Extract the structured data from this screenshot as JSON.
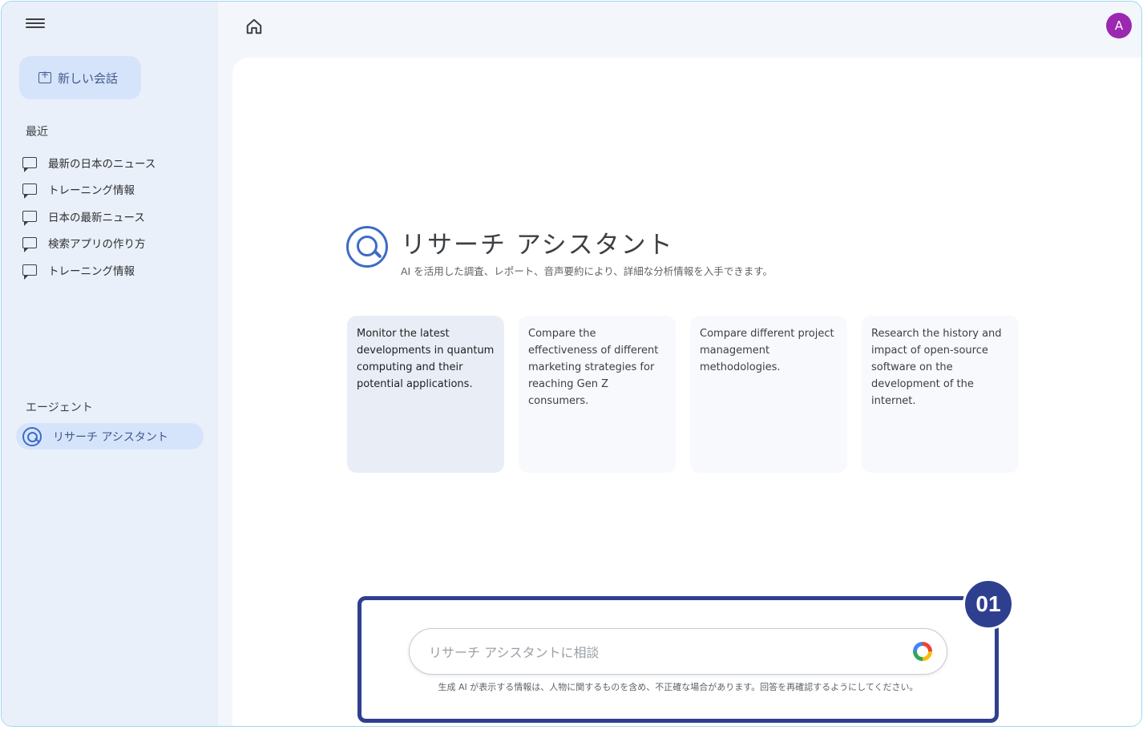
{
  "sidebar": {
    "new_chat_label": "新しい会話",
    "recent_label": "最近",
    "recent_items": [
      {
        "label": "最新の日本のニュース"
      },
      {
        "label": "トレーニング情報"
      },
      {
        "label": "日本の最新ニュース"
      },
      {
        "label": "検索アプリの作り方"
      },
      {
        "label": "トレーニング情報"
      }
    ],
    "agents_label": "エージェント",
    "agent_item_label": "リサーチ アシスタント"
  },
  "header": {
    "avatar_initial": "A"
  },
  "hero": {
    "title": "リサーチ アシスタント",
    "subtitle": "AI を活用した調査、レポート、音声要約により、詳細な分析情報を入手できます。"
  },
  "suggestions": [
    {
      "text": "Monitor the latest developments in quantum computing and their potential applications."
    },
    {
      "text": "Compare the effectiveness of different marketing strategies for reaching Gen Z consumers."
    },
    {
      "text": "Compare different project management methodologies."
    },
    {
      "text": "Research the history and impact of open-source software on the development of the internet."
    }
  ],
  "input": {
    "placeholder": "リサーチ アシスタントに相談",
    "disclaimer": "生成 AI が表示する情報は、人物に関するものを含め、不正確な場合があります。回答を再確認するようにしてください。"
  },
  "annotation": {
    "badge": "01",
    "accent_color": "#2f3f8f"
  }
}
